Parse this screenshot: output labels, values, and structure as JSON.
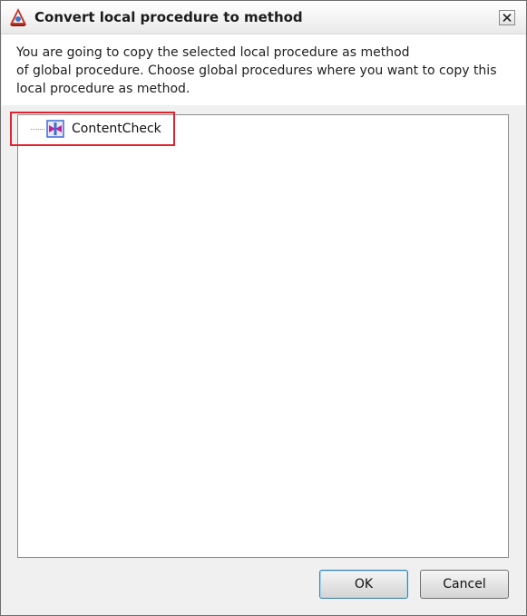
{
  "window": {
    "title": "Convert local procedure to method"
  },
  "description": {
    "line1": "You are going to copy the selected local procedure as method",
    "line2": "of global procedure. Choose global procedures where you want to copy this",
    "line3": "local procedure as method."
  },
  "tree": {
    "items": [
      {
        "label": "ContentCheck",
        "icon": "local-procedure-icon"
      }
    ]
  },
  "buttons": {
    "ok_label": "OK",
    "cancel_label": "Cancel"
  },
  "colors": {
    "highlight": "#e0232f",
    "icon_magenta": "#c0209a",
    "icon_blue": "#3d6bd6"
  }
}
